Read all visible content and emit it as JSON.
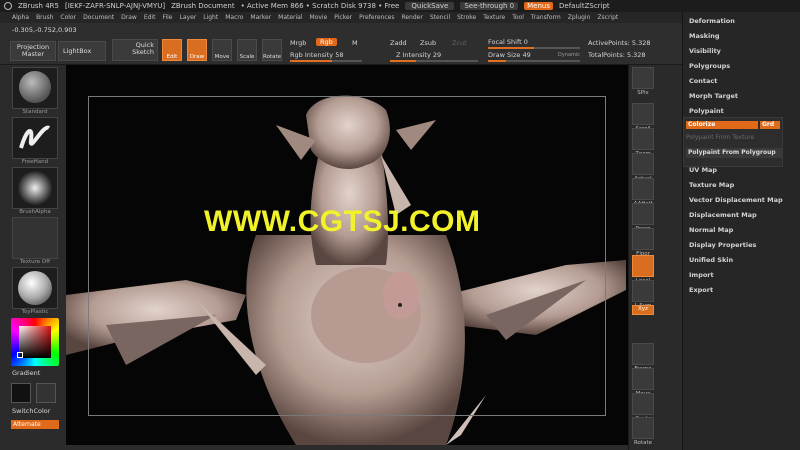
{
  "titlebar": {
    "app": "ZBrush 4R5",
    "serial": "[IEKF-ZAFR-SNLP-AJNJ-VMYU]",
    "document": "ZBrush Document",
    "mem": "• Active Mem 866 • Scratch Disk 9738 • Free",
    "quicksave": "QuickSave",
    "seethrough": "See-through  0",
    "menus": "Menus",
    "script": "DefaultZScript"
  },
  "menubar": [
    "Alpha",
    "Brush",
    "Color",
    "Document",
    "Draw",
    "Edit",
    "File",
    "Layer",
    "Light",
    "Macro",
    "Marker",
    "Material",
    "Movie",
    "Picker",
    "Preferences",
    "Render",
    "Stencil",
    "Stroke",
    "Texture",
    "Tool",
    "Transform",
    "Zplugin",
    "Zscript"
  ],
  "shelf": {
    "coords": "-0.305,-0.752,0.903",
    "projection_master": "Projection\nMaster",
    "lightbox": "LightBox",
    "quick_sketch": "Quick\nSketch",
    "tools": [
      {
        "label": "Edit",
        "active": true
      },
      {
        "label": "Draw",
        "active": true
      },
      {
        "label": "Move",
        "active": false
      },
      {
        "label": "Scale",
        "active": false
      },
      {
        "label": "Rotate",
        "active": false
      }
    ],
    "mrgb": "Mrgb",
    "rgb": "Rgb",
    "m": "M",
    "rgb_intensity": "Rgb Intensity 58",
    "zadd": "Zadd",
    "zsub": "Zsub",
    "zcut": "Zcut",
    "z_intensity": "Z Intensity 29",
    "focal_shift": "Focal Shift 0",
    "draw_size": "Draw Size 49",
    "dynamic": "Dynamic",
    "active_points": "ActivePoints: 5.328",
    "total_points": "TotalPoints: 5.328"
  },
  "leftpanel": {
    "brush_label": "Standard",
    "stroke_label": "FreeHand",
    "alpha_label": "BrushAlpha",
    "texture_label": "Texture Off",
    "material_label": "ToyPlastic",
    "gradient": "Gradient",
    "switchcolor": "SwitchColor",
    "alternate": "Alternate"
  },
  "viewport": {
    "watermark": "WWW.CGTSJ.COM"
  },
  "iconcol": [
    "SPix",
    "Scroll",
    "Zoom",
    "Actual",
    "AAHalf",
    "Persp",
    "Floor",
    "Local",
    "L.Sym",
    "Xyz",
    "Frame",
    "Move",
    "Scale",
    "Rotate"
  ],
  "rightpanel": {
    "items_top": [
      "Deformation",
      "Masking",
      "Visibility",
      "Polygroups",
      "Contact",
      "Morph Target"
    ],
    "polypaint": "Polypaint",
    "colorize": "Colorize",
    "grd": "Grd",
    "pp_from_texture": "Polypaint From Texture",
    "pp_from_polygroup": "Polypaint From Polygroup",
    "items_bottom": [
      "UV Map",
      "Texture Map",
      "Vector Displacement Map",
      "Displacement Map",
      "Normal Map",
      "Display Properties",
      "Unified Skin",
      "Import",
      "Export"
    ]
  },
  "colors": {
    "accent": "#e06a1a",
    "watermark": "#f2f22a"
  }
}
